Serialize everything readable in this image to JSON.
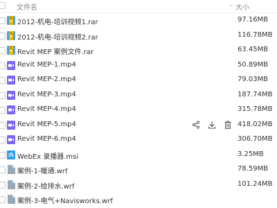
{
  "header": {
    "name_label": "文件名",
    "size_label": "大小",
    "sort_indicator": "⌄"
  },
  "files": [
    {
      "name": "2012-机电-培训视频1.rar",
      "size": "97.16MB",
      "icon": "rar-archive-icon",
      "color": "#f0b400"
    },
    {
      "name": "2012-机电-培训视频2.rar",
      "size": "116.78MB",
      "icon": "rar-archive-icon",
      "color": "#f0b400"
    },
    {
      "name": "Revit MEP 案例文件.rar",
      "size": "63.45MB",
      "icon": "rar-archive-icon",
      "color": "#f0b400"
    },
    {
      "name": "Revit MEP-1.mp4",
      "size": "50.89MB",
      "icon": "video-file-icon",
      "color": "#7b68ee"
    },
    {
      "name": "Revit MEP-2.mp4",
      "size": "79.03MB",
      "icon": "video-file-icon",
      "color": "#7b68ee"
    },
    {
      "name": "Revit MEP-3.mp4",
      "size": "187.74MB",
      "icon": "video-file-icon",
      "color": "#7b68ee"
    },
    {
      "name": "Revit MEP-4.mp4",
      "size": "315.78MB",
      "icon": "video-file-icon",
      "color": "#7b68ee"
    },
    {
      "name": "Revit MEP-5.mp4",
      "size": "418.02MB",
      "icon": "video-file-icon",
      "color": "#7b68ee"
    },
    {
      "name": "Revit MEP-6.mp4",
      "size": "306.70MB",
      "icon": "video-file-icon",
      "color": "#7b68ee"
    },
    {
      "name": "WebEx 录播器.msi",
      "size": "3.25MB",
      "icon": "installer-file-icon",
      "color": "#2f9be8"
    },
    {
      "name": "案例-1-暖通.wrf",
      "size": "78.59MB",
      "icon": "generic-file-icon",
      "color": "#9aa7b5"
    },
    {
      "name": "案例-2-给排水.wrf",
      "size": "101.24MB",
      "icon": "generic-file-icon",
      "color": "#9aa7b5"
    },
    {
      "name": "案例-3-电气+Navisworks.wrf",
      "size": "",
      "icon": "generic-file-icon",
      "color": "#9aa7b5"
    }
  ],
  "hover_row_index": 7,
  "row_actions": [
    "share-icon",
    "download-icon",
    "delete-icon"
  ]
}
